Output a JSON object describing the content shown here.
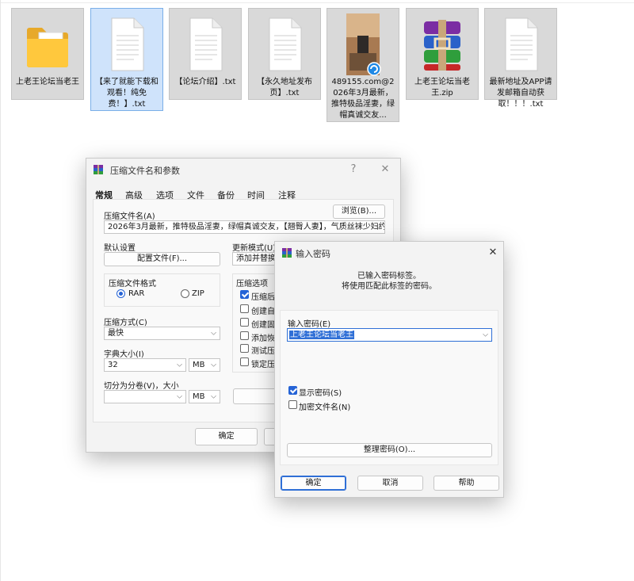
{
  "desktop": {
    "files": [
      {
        "label": "上老王论坛当老王",
        "icon": "folder-icon"
      },
      {
        "label": "【来了就能下载和观看！纯免费！】.txt",
        "icon": "text-file-icon"
      },
      {
        "label": "【论坛介绍】.txt",
        "icon": "text-file-icon"
      },
      {
        "label": "【永久地址发布页】.txt",
        "icon": "text-file-icon"
      },
      {
        "label": "489155.com@2026年3月最新，推特极品淫妻，绿帽真诚交友...",
        "icon": "video-thumbnail-icon"
      },
      {
        "label": "上老王论坛当老王.zip",
        "icon": "winrar-archive-icon"
      },
      {
        "label": "最新地址及APP请发邮箱自动获取！！！.txt",
        "icon": "text-file-icon"
      }
    ]
  },
  "archive_dialog": {
    "title": "压缩文件名和参数",
    "help": "?",
    "close": "✕",
    "tabs": [
      "常规",
      "高级",
      "选项",
      "文件",
      "备份",
      "时间",
      "注释"
    ],
    "archive_name_label": "压缩文件名(A)",
    "browse_label": "浏览(B)...",
    "archive_name_value": "2026年3月最新，推特极品淫妻，绿帽真诚交友，【翘臀人妻】，气质丝袜少妇约",
    "default_settings_label": "默认设置",
    "profiles_label": "配置文件(F)...",
    "update_mode_label": "更新模式(U)",
    "update_mode_value": "添加并替换文",
    "format_label": "压缩文件格式",
    "format_rar": "RAR",
    "format_zip": "ZIP",
    "options_label": "压缩选项",
    "options": [
      "压缩后删",
      "创建自",
      "创建固",
      "添加恢",
      "测试压",
      "锁定压"
    ],
    "method_label": "压缩方式(C)",
    "method_value": "最快",
    "dict_label": "字典大小(I)",
    "dict_value": "32",
    "dict_unit": "MB",
    "split_label": "切分为分卷(V)，大小",
    "split_value": "",
    "split_unit": "MB",
    "ok_label": "确定"
  },
  "password_dialog": {
    "title": "输入密码",
    "close": "✕",
    "info_line1": "已输入密码标签。",
    "info_line2": "将使用匹配此标签的密码。",
    "password_label": "输入密码(E)",
    "password_value": "上老王论坛当老王",
    "show_password_label": "显示密码(S)",
    "encrypt_names_label": "加密文件名(N)",
    "organize_label": "整理密码(O)...",
    "ok_label": "确定",
    "cancel_label": "取消",
    "help_label": "帮助"
  }
}
